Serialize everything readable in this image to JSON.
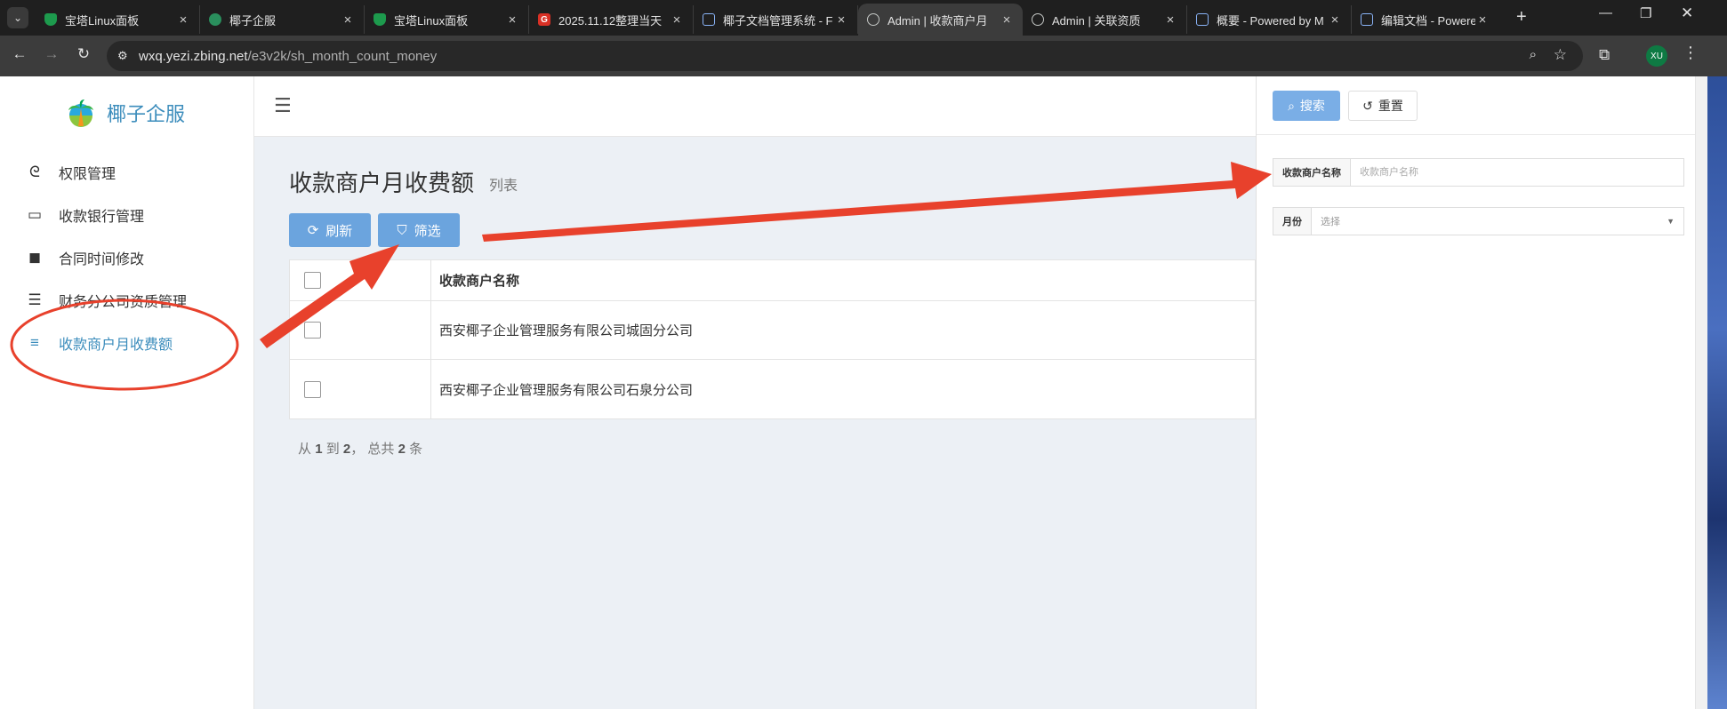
{
  "browser": {
    "tabs": [
      {
        "title": "宝塔Linux面板",
        "icon": "shield-favicon",
        "active": false
      },
      {
        "title": "椰子企服",
        "icon": "leaf-favicon",
        "active": false
      },
      {
        "title": "宝塔Linux面板",
        "icon": "shield-favicon",
        "active": false
      },
      {
        "title": "2025.11.12整理当天",
        "icon": "g-favicon",
        "active": false
      },
      {
        "title": "椰子文档管理系统 - F",
        "icon": "edit-favicon",
        "active": false
      },
      {
        "title": "Admin | 收款商户月",
        "icon": "globe-favicon",
        "active": true
      },
      {
        "title": "Admin | 关联资质",
        "icon": "globe-favicon",
        "active": false
      },
      {
        "title": "概要 - Powered by M",
        "icon": "edit-favicon",
        "active": false
      },
      {
        "title": "编辑文档 - Powered",
        "icon": "edit-favicon",
        "active": false
      }
    ],
    "g_favicon_letter": "G",
    "url_host": "wxq.yezi.zbing.net",
    "url_path": "/e3v2k/sh_month_count_money",
    "profile_initials": "XU"
  },
  "sidebar": {
    "brand": "椰子企服",
    "items": [
      {
        "label": "权限管理",
        "icon": "fingerprint-icon",
        "active": false
      },
      {
        "label": "收款银行管理",
        "icon": "credit-card-icon",
        "active": false
      },
      {
        "label": "合同时间修改",
        "icon": "sticky-note-icon",
        "active": false
      },
      {
        "label": "财务分公司资质管理",
        "icon": "indent-list-icon",
        "active": false
      },
      {
        "label": "收款商户月收费额",
        "icon": "align-center-icon",
        "active": true
      }
    ]
  },
  "main": {
    "title": "收款商户月收费额",
    "subtitle": "列表",
    "refresh_label": "刷新",
    "filter_label": "筛选",
    "table": {
      "header": "收款商户名称",
      "rows": [
        "西安椰子企业管理服务有限公司城固分公司",
        "西安椰子企业管理服务有限公司石泉分公司"
      ]
    },
    "pager": {
      "prefix": "从",
      "from": "1",
      "to_word": "到",
      "to": "2",
      "total_word": "，  总共",
      "total": "2",
      "suffix": "条"
    }
  },
  "filter_panel": {
    "search_label": "搜索",
    "reset_label": "重置",
    "merchant_label": "收款商户名称",
    "merchant_placeholder": "收款商户名称",
    "merchant_value": "",
    "month_label": "月份",
    "month_value": "选择"
  },
  "colors": {
    "accent": "#3c8dbc",
    "button": "#6ba4de",
    "annotation": "#e8412c"
  }
}
